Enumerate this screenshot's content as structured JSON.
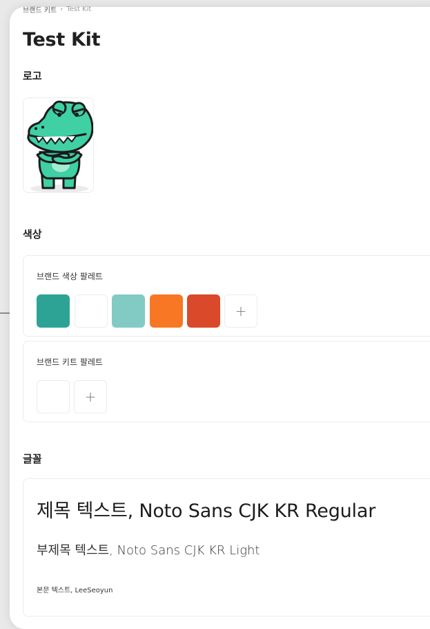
{
  "breadcrumb": {
    "first": "브랜드 키트",
    "separator": "›",
    "current": "Test Kit"
  },
  "page_title": "Test Kit",
  "sections": {
    "logo": "로고",
    "colors": "색상",
    "fonts": "글꼴"
  },
  "color_palettes": {
    "brand_label": "브랜드 색상 팔레트",
    "brand_colors": [
      "#2da396",
      "#ffffff",
      "#82cbc4",
      "#f87725",
      "#d9492a"
    ],
    "kit_label": "브랜드 키트 팔레트",
    "add_symbol": "+"
  },
  "fonts": {
    "title_sample": "제목 텍스트, Noto Sans CJK KR Regular",
    "subtitle_sample": "부제목 텍스트, Noto Sans CJK KR Light",
    "body_sample": "본문 텍스트, LeeSeoyun"
  }
}
